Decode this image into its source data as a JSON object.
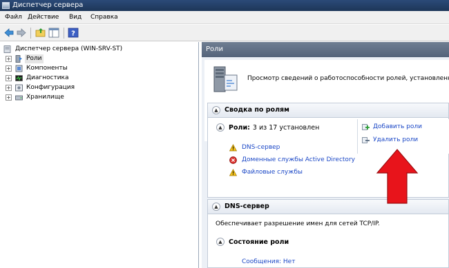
{
  "window": {
    "title": "Диспетчер сервера"
  },
  "menu": [
    "Файл",
    "Действие",
    "Вид",
    "Справка"
  ],
  "toolbar": {
    "icons": [
      "back-arrow-icon",
      "forward-arrow-icon",
      "up-folder-icon",
      "show-hide-tree-icon",
      "help-icon"
    ]
  },
  "tree": {
    "root": "Диспетчер сервера (WIN-SRV-ST)",
    "items": [
      {
        "label": "Роли",
        "icon": "roles-icon"
      },
      {
        "label": "Компоненты",
        "icon": "features-icon"
      },
      {
        "label": "Диагностика",
        "icon": "diagnostics-icon"
      },
      {
        "label": "Конфигурация",
        "icon": "configuration-icon"
      },
      {
        "label": "Хранилище",
        "icon": "storage-icon"
      }
    ]
  },
  "pane": {
    "title": "Роли",
    "description": "Просмотр сведений о работоспособности ролей, установленных на"
  },
  "summary": {
    "header": "Сводка по ролям",
    "roles_label": "Роли:",
    "roles_count": "3 из 17 установлен",
    "roles": [
      {
        "name": "DNS-сервер",
        "status_icon": "warning-icon"
      },
      {
        "name": "Доменные службы Active Directory",
        "status_icon": "error-icon"
      },
      {
        "name": "Файловые службы",
        "status_icon": "warning-icon"
      }
    ],
    "actions": {
      "add": "Добавить роли",
      "remove": "Удалить роли"
    }
  },
  "dns": {
    "header": "DNS-сервер",
    "description": "Обеспечивает разрешение имен для сетей TCP/IP.",
    "state_header": "Состояние роли",
    "messages_link": "Сообщения: Нет"
  },
  "colors": {
    "titlebar": "#1d3658",
    "link": "#1a47c6",
    "pane_header": "#5c6b82",
    "arrow": "#e8141b"
  }
}
